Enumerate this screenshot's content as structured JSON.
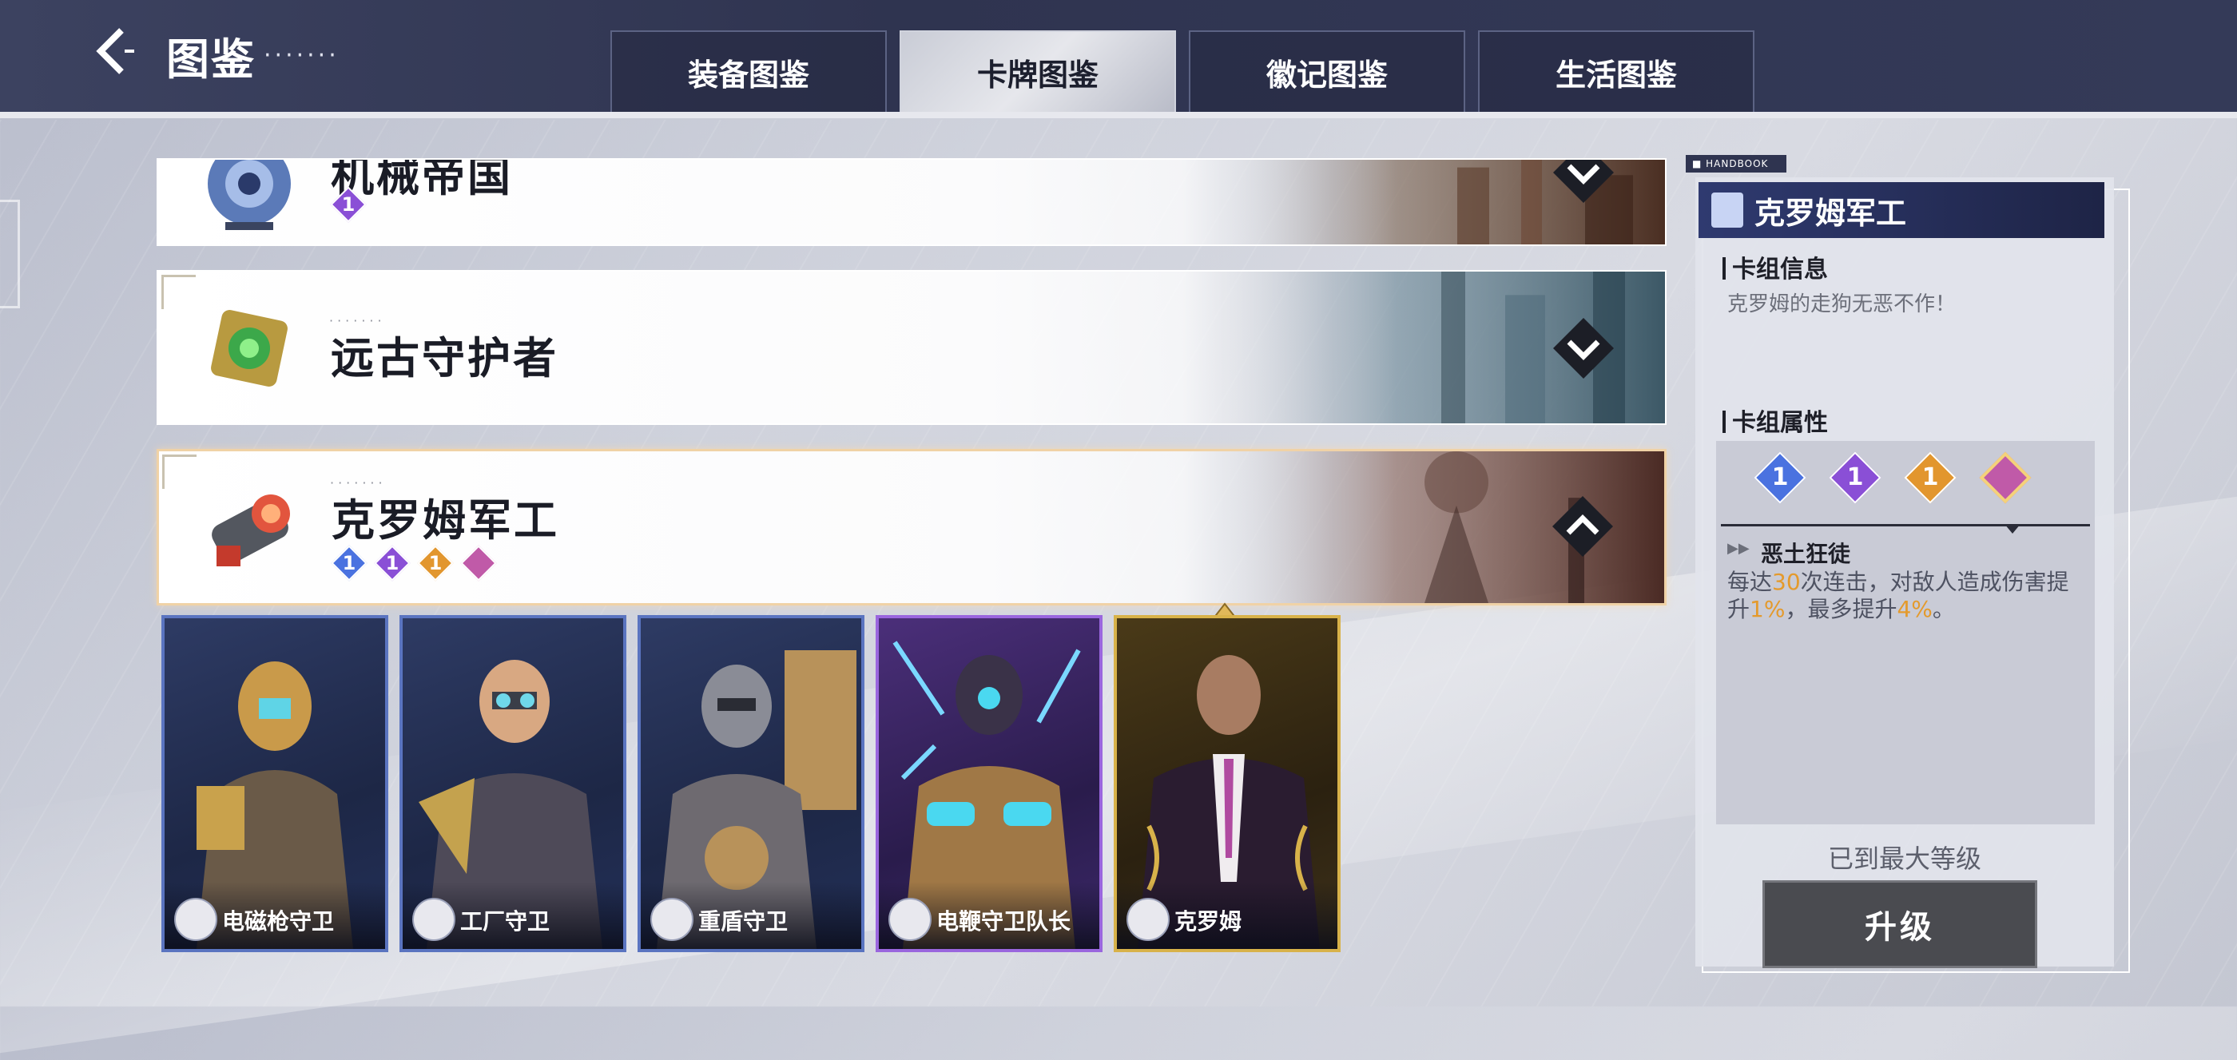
{
  "header": {
    "title": "图鉴",
    "title_dots": "·······",
    "tabs": [
      {
        "label": "装备图鉴",
        "active": false
      },
      {
        "label": "卡牌图鉴",
        "active": true
      },
      {
        "label": "徽记图鉴",
        "active": false
      },
      {
        "label": "生活图鉴",
        "active": false
      }
    ]
  },
  "decks": [
    {
      "name": "机械帝国",
      "dots": "·······",
      "badges": [
        {
          "value": "1",
          "color": "#8a4fd6"
        }
      ],
      "expanded": false
    },
    {
      "name": "远古守护者",
      "dots": "·······",
      "badges": [],
      "expanded": false
    },
    {
      "name": "克罗姆军工",
      "dots": "·······",
      "badges": [
        {
          "value": "1",
          "color": "#4a72e0"
        },
        {
          "value": "1",
          "color": "#8a4fd6"
        },
        {
          "value": "1",
          "color": "#e2962e"
        },
        {
          "value": "",
          "color": "#c05aa8"
        }
      ],
      "expanded": true
    }
  ],
  "cards": [
    {
      "name": "电磁枪守卫",
      "rarity": "blue"
    },
    {
      "name": "工厂守卫",
      "rarity": "blue"
    },
    {
      "name": "重盾守卫",
      "rarity": "blue"
    },
    {
      "name": "电鞭守卫队长",
      "rarity": "purple"
    },
    {
      "name": "克罗姆",
      "rarity": "gold"
    }
  ],
  "panel": {
    "tag": "■ HANDBOOK",
    "deck_name": "克罗姆军工",
    "info_heading": "卡组信息",
    "info_text": "克罗姆的走狗无恶不作！",
    "attr_heading": "卡组属性",
    "attr_gems": [
      {
        "value": "1",
        "color": "#4a72e0"
      },
      {
        "value": "1",
        "color": "#8a4fd6"
      },
      {
        "value": "1",
        "color": "#e2962e"
      },
      {
        "value": "",
        "color": "#c05aa8"
      }
    ],
    "effect_name": "恶土狂徒",
    "effect_parts": [
      "每达",
      "30",
      "次连击，对敌人造成伤害提升",
      "1%",
      "，最多提升",
      "4%",
      "。"
    ],
    "max_level": "已到最大等级",
    "upgrade_label": "升级"
  }
}
